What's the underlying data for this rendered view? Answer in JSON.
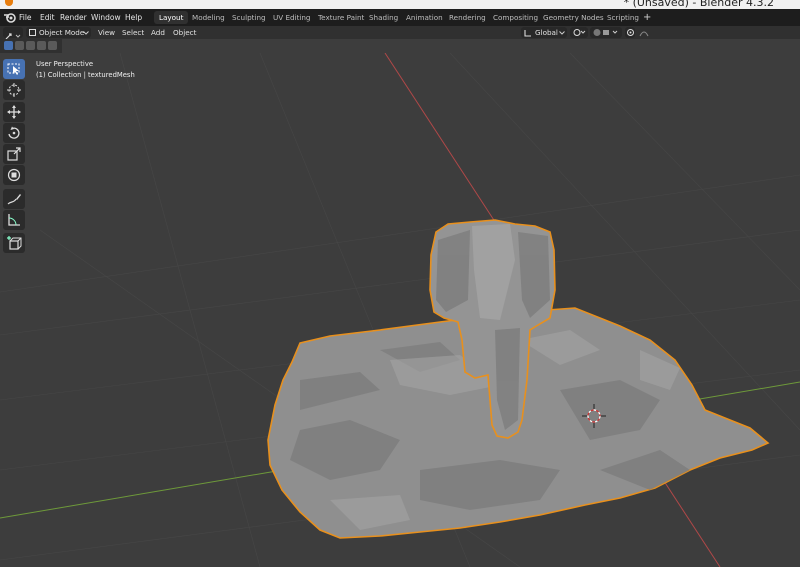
{
  "window": {
    "title": "* (Unsaved) - Blender 4.3.2"
  },
  "menubar": {
    "items": [
      "File",
      "Edit",
      "Render",
      "Window",
      "Help"
    ],
    "workspaces": [
      "Layout",
      "Modeling",
      "Sculpting",
      "UV Editing",
      "Texture Paint",
      "Shading",
      "Animation",
      "Rendering",
      "Compositing",
      "Geometry Nodes",
      "Scripting"
    ],
    "active_workspace": "Layout",
    "add_workspace": "+"
  },
  "header": {
    "mode": "Object Mode",
    "menus": [
      "View",
      "Select",
      "Add",
      "Object"
    ],
    "transform_orientation": "Global"
  },
  "viewport": {
    "view_name": "User Perspective",
    "collection_info": "(1) Collection | texturedMesh"
  },
  "toolbar": {
    "tools": [
      "select-box-tool",
      "cursor-tool",
      "move-tool",
      "rotate-tool",
      "scale-tool",
      "transform-tool",
      "annotate-tool",
      "measure-tool",
      "add-cube-tool"
    ],
    "active_tool": "select-box-tool"
  },
  "colors": {
    "selection_outline": "#e8901d",
    "active_tool": "#4772b3",
    "x_axis": "#b04848",
    "y_axis": "#6e9a3a"
  }
}
